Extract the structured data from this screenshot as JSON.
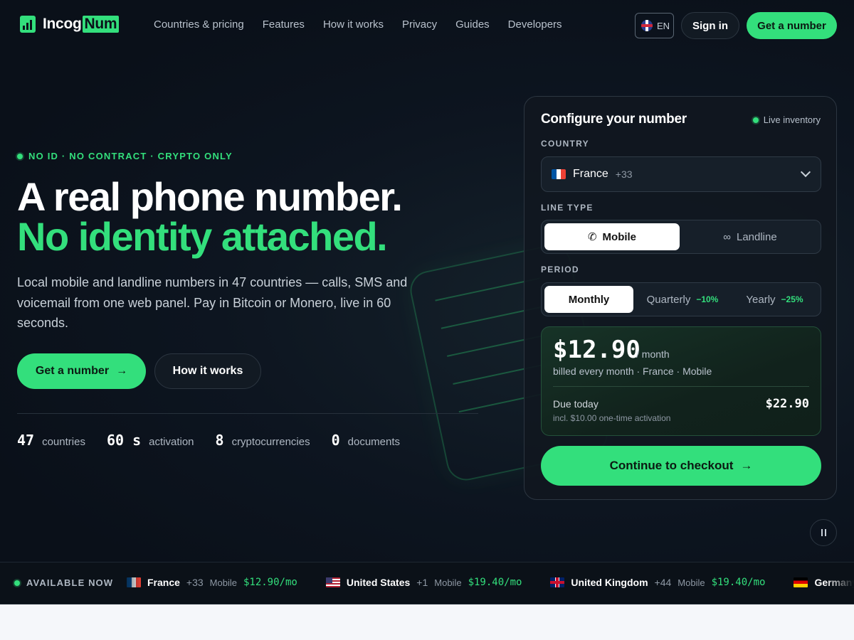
{
  "brand": {
    "name_part1": "Incog",
    "name_part2": "Num"
  },
  "nav": {
    "links": [
      "Countries & pricing",
      "Features",
      "How it works",
      "Privacy",
      "Guides",
      "Developers"
    ],
    "lang": "EN",
    "signin": "Sign in",
    "get_number": "Get a number"
  },
  "hero": {
    "eyebrow": "NO ID · NO CONTRACT · CRYPTO ONLY",
    "title_line1": "A real phone number.",
    "title_line2": "No identity attached.",
    "lead": "Local mobile and landline numbers in 47 countries — calls, SMS and voicemail from one web panel. Pay in Bitcoin or Monero, live in 60 seconds.",
    "cta_primary": "Get a number",
    "cta_secondary": "How it works",
    "stats": [
      {
        "value": "47",
        "label": "countries"
      },
      {
        "value": "60 s",
        "label": "activation"
      },
      {
        "value": "8",
        "label": "cryptocurrencies"
      },
      {
        "value": "0",
        "label": "documents"
      }
    ]
  },
  "config": {
    "title": "Configure your number",
    "live_label": "Live inventory",
    "country_label": "COUNTRY",
    "country_selected": "France",
    "country_code": "+33",
    "line_type_label": "LINE TYPE",
    "line_types": [
      "Mobile",
      "Landline"
    ],
    "period_label": "PERIOD",
    "periods": [
      {
        "label": "Monthly",
        "discount": ""
      },
      {
        "label": "Quarterly",
        "discount": "−10%"
      },
      {
        "label": "Yearly",
        "discount": "−25%"
      }
    ],
    "price": "$12.90",
    "price_per": "/ month",
    "price_sub": "billed every month · France · Mobile",
    "due_label": "Due today",
    "due_sub": "incl. $10.00 one-time activation",
    "due_amount": "$22.90",
    "checkout": "Continue to checkout",
    "accent": "#33df7c"
  },
  "ticker": {
    "label": "AVAILABLE NOW",
    "items": [
      {
        "country": "France",
        "code": "+33",
        "type": "Mobile",
        "price": "$12.90/mo"
      },
      {
        "country": "United States",
        "code": "+1",
        "type": "Mobile",
        "price": "$19.40/mo"
      },
      {
        "country": "United Kingdom",
        "code": "+44",
        "type": "Mobile",
        "price": "$19.40/mo"
      },
      {
        "country": "Germany",
        "code": "",
        "type": "",
        "price": ""
      }
    ]
  }
}
